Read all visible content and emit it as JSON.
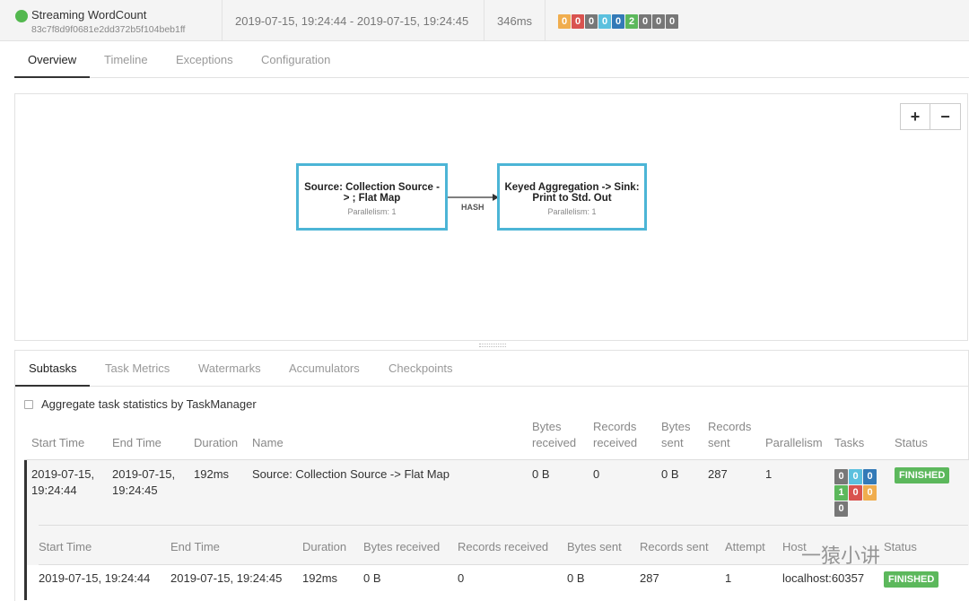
{
  "header": {
    "job_name": "Streaming WordCount",
    "job_id": "83c7f8d9f0681e2dd372b5f104beb1ff",
    "time_range": "2019-07-15, 19:24:44 - 2019-07-15, 19:24:45",
    "duration": "346ms",
    "task_counts": [
      {
        "value": "0",
        "color": "#f0ad4e"
      },
      {
        "value": "0",
        "color": "#d9534f"
      },
      {
        "value": "0",
        "color": "#777777"
      },
      {
        "value": "0",
        "color": "#5bc0de"
      },
      {
        "value": "0",
        "color": "#337ab7"
      },
      {
        "value": "2",
        "color": "#5cb85c"
      },
      {
        "value": "0",
        "color": "#777777"
      },
      {
        "value": "0",
        "color": "#777777"
      },
      {
        "value": "0",
        "color": "#777777"
      }
    ]
  },
  "main_tabs": [
    "Overview",
    "Timeline",
    "Exceptions",
    "Configuration"
  ],
  "graph": {
    "zoom_in": "+",
    "zoom_out": "−",
    "nodes": [
      {
        "title": "Source: Collection Source -> ; Flat Map",
        "parallelism": "Parallelism: 1"
      },
      {
        "title": "Keyed Aggregation -> Sink: Print to Std. Out",
        "parallelism": "Parallelism: 1"
      }
    ],
    "edge_label": "HASH"
  },
  "sub_tabs": [
    "Subtasks",
    "Task Metrics",
    "Watermarks",
    "Accumulators",
    "Checkpoints"
  ],
  "aggregate_label": "Aggregate task statistics by TaskManager",
  "table": {
    "headers": {
      "start": "Start Time",
      "end": "End Time",
      "duration": "Duration",
      "name": "Name",
      "bytes_received_1": "Bytes",
      "bytes_received_2": "received",
      "records_received_1": "Records",
      "records_received_2": "received",
      "bytes_sent_1": "Bytes",
      "bytes_sent_2": "sent",
      "records_sent_1": "Records",
      "records_sent_2": "sent",
      "parallelism": "Parallelism",
      "tasks": "Tasks",
      "status": "Status"
    },
    "row": {
      "start_date": "2019-07-15,",
      "start_time": "19:24:44",
      "end_date": "2019-07-15,",
      "end_time": "19:24:45",
      "duration": "192ms",
      "name": "Source: Collection Source -> Flat Map",
      "bytes_received": "0 B",
      "records_received": "0",
      "bytes_sent": "0 B",
      "records_sent": "287",
      "parallelism": "1",
      "tasks": [
        {
          "value": "0",
          "color": "#777777"
        },
        {
          "value": "0",
          "color": "#5bc0de"
        },
        {
          "value": "0",
          "color": "#337ab7"
        },
        {
          "value": "1",
          "color": "#5cb85c"
        },
        {
          "value": "0",
          "color": "#d9534f"
        },
        {
          "value": "0",
          "color": "#f0ad4e"
        },
        {
          "value": "0",
          "color": "#777777"
        }
      ],
      "status": "FINISHED"
    },
    "sub_headers": {
      "start": "Start Time",
      "end": "End Time",
      "duration": "Duration",
      "bytes_received": "Bytes received",
      "records_received": "Records received",
      "bytes_sent": "Bytes sent",
      "records_sent": "Records sent",
      "attempt": "Attempt",
      "host": "Host",
      "status": "Status"
    },
    "sub_row": {
      "start": "2019-07-15, 19:24:44",
      "end": "2019-07-15, 19:24:45",
      "duration": "192ms",
      "bytes_received": "0 B",
      "records_received": "0",
      "bytes_sent": "0 B",
      "records_sent": "287",
      "attempt": "1",
      "host": "localhost:60357",
      "status": "FINISHED"
    }
  },
  "watermark": "一猿小讲",
  "colors": {
    "accent": "#4cb5d6",
    "success": "#5cb85c",
    "running": "#53b84f"
  }
}
